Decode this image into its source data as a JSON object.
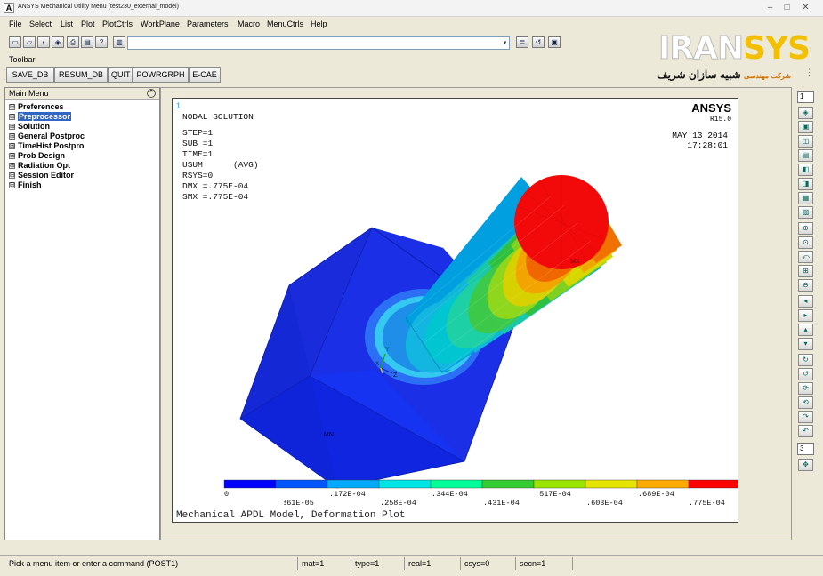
{
  "window": {
    "title": "ANSYS Mechanical Utility Menu (test230_external_model)",
    "app_icon_letter": "A",
    "controls": [
      "–",
      "□",
      "✕"
    ]
  },
  "menubar": {
    "items": [
      "File",
      "Select",
      "List",
      "Plot",
      "PlotCtrls",
      "WorkPlane",
      "Parameters",
      "Macro",
      "MenuCtrls",
      "Help"
    ]
  },
  "command": {
    "input_value": "",
    "toolbar_label": "Toolbar"
  },
  "logo": {
    "iran": "IRAN",
    "sys": "SYS",
    "persian_prefix": "شرکت مهندسی",
    "persian_main": "شبیه سازان شریف"
  },
  "buttons": [
    "SAVE_DB",
    "RESUM_DB",
    "QUIT",
    "POWRGRPH",
    "E-CAE"
  ],
  "main_menu": {
    "header": "Main Menu",
    "items": [
      {
        "label": "Preferences",
        "box": "⊟"
      },
      {
        "label": "Preprocessor",
        "box": "⊞",
        "selected": true
      },
      {
        "label": "Solution",
        "box": "⊞"
      },
      {
        "label": "General Postproc",
        "box": "⊞"
      },
      {
        "label": "TimeHist Postpro",
        "box": "⊞"
      },
      {
        "label": "Prob Design",
        "box": "⊞"
      },
      {
        "label": "Radiation Opt",
        "box": "⊞"
      },
      {
        "label": "Session Editor",
        "box": "⊟"
      },
      {
        "label": "Finish",
        "box": "⊟"
      }
    ]
  },
  "graphics": {
    "window_number": "1",
    "info_lines": [
      "NODAL SOLUTION",
      "",
      "STEP=1",
      "SUB =1",
      "TIME=1",
      "USUM      (AVG)",
      "RSYS=0",
      "DMX =.775E-04",
      "SMX =.775E-04"
    ],
    "brand": "ANSYS",
    "release": "R15.0",
    "date": "MAY 13 2014",
    "time": "17:28:01",
    "node_label_mx": "MX",
    "node_label_mn": "MN",
    "triad_y": "Y",
    "triad_z": "Z",
    "triad_x": "X",
    "footer": "Mechanical APDL Model, Deformation Plot",
    "legend": {
      "colors": [
        "#0000ff",
        "#0055ff",
        "#00aaff",
        "#00e5e5",
        "#00ff99",
        "#33cc33",
        "#99e500",
        "#e5e500",
        "#ffaa00",
        "#ff0000"
      ],
      "labels_top": [
        "0",
        ".172E-04",
        ".344E-04",
        ".517E-04",
        ".689E-04"
      ],
      "labels_bottom": [
        ".861E-05",
        ".258E-04",
        ".431E-04",
        ".603E-04",
        ".775E-04"
      ]
    }
  },
  "right_toolbar": {
    "top_select": "1",
    "mid_select": "3"
  },
  "status": {
    "prompt": "Pick a menu item or enter a command (POST1)",
    "mat": "mat=1",
    "type": "type=1",
    "real": "real=1",
    "csys": "csys=0",
    "secn": "secn=1"
  }
}
